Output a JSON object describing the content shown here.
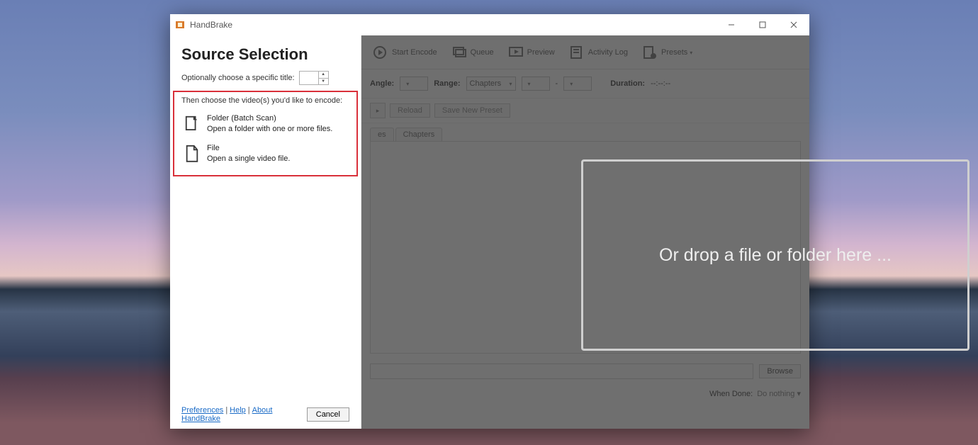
{
  "window": {
    "title": "HandBrake"
  },
  "source_panel": {
    "heading": "Source Selection",
    "subtitle": "Optionally choose a specific title:",
    "choose_caption": "Then choose the video(s) you'd like to encode:",
    "folder": {
      "title": "Folder (Batch Scan)",
      "desc": "Open a folder with one or more files."
    },
    "file": {
      "title": "File",
      "desc": "Open a single video file."
    },
    "cancel": "Cancel",
    "links": {
      "preferences": "Preferences",
      "help": "Help",
      "about": "About HandBrake"
    }
  },
  "toolbar": {
    "start_encode": "Start Encode",
    "queue": "Queue",
    "preview": "Preview",
    "activity_log": "Activity Log",
    "presets": "Presets"
  },
  "fields": {
    "angle_label": "Angle:",
    "range_label": "Range:",
    "range_value": "Chapters",
    "range_sep": "-",
    "duration_label": "Duration:",
    "duration_value": "--:--:--",
    "reload": "Reload",
    "save_preset": "Save New Preset"
  },
  "tabs": {
    "partial1": "es",
    "chapters": "Chapters"
  },
  "dropzone": "Or drop a file or folder here ...",
  "bottom": {
    "browse": "Browse",
    "when_done_label": "When Done:",
    "when_done_value": "Do nothing"
  }
}
